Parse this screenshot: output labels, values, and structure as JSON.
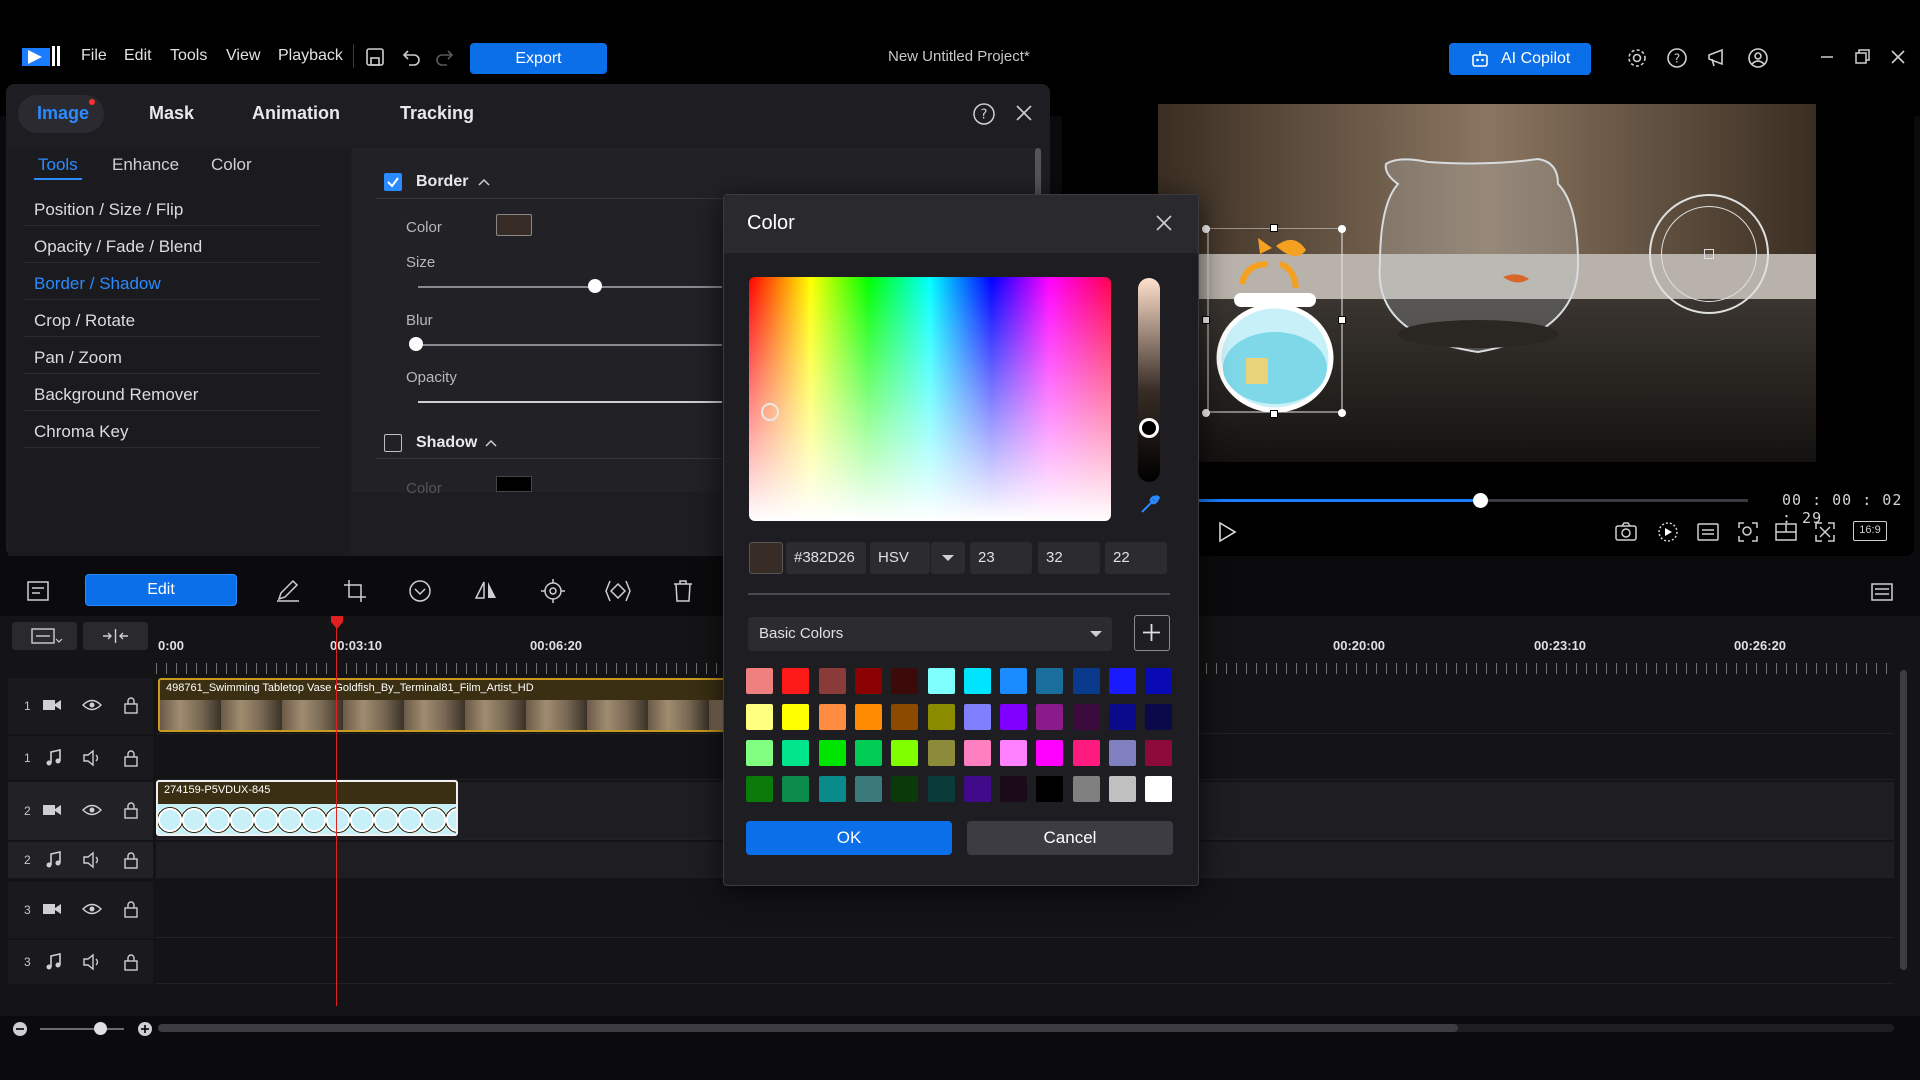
{
  "menu": [
    "File",
    "Edit",
    "Tools",
    "View",
    "Playback"
  ],
  "toolbar": {
    "export_label": "Export",
    "project_title": "New Untitled Project*",
    "ai_label": "AI Copilot"
  },
  "edit_panel": {
    "tabs": [
      "Image",
      "Mask",
      "Animation",
      "Tracking"
    ],
    "subtabs": [
      "Tools",
      "Enhance",
      "Color"
    ],
    "tools": [
      "Position / Size / Flip",
      "Opacity / Fade / Blend",
      "Border / Shadow",
      "Crop / Rotate",
      "Pan / Zoom",
      "Background Remover",
      "Chroma Key"
    ],
    "border": {
      "label": "Border",
      "enabled": true,
      "color_label": "Color",
      "size_label": "Size",
      "blur_label": "Blur",
      "opacity_label": "Opacity"
    },
    "shadow": {
      "label": "Shadow",
      "enabled": false,
      "color_label": "Color"
    }
  },
  "preview": {
    "timecode": "00 : 00 : 02 : 29",
    "aspect": "16:9",
    "progress": 0.52
  },
  "timeline": {
    "edit_label": "Edit",
    "ruler": [
      "0:00",
      "00:03:10",
      "00:06:20",
      "00:20:00",
      "00:23:10",
      "00:26:20"
    ],
    "track_numbers": [
      "1",
      "1",
      "2",
      "2",
      "3",
      "3"
    ],
    "clip1_name": "498761_Swimming Tabletop Vase Goldfish_By_Terminal81_Film_Artist_HD",
    "clip2_name": "274159-P5VDUX-845"
  },
  "color_dialog": {
    "title": "Color",
    "hex": "#382D26",
    "mode": "HSV",
    "h": "23",
    "s": "32",
    "v": "22",
    "palette_label": "Basic Colors",
    "ok_label": "OK",
    "cancel_label": "Cancel",
    "swatches": [
      [
        "#f08080",
        "#ff1a1a",
        "#8b3a3a",
        "#8b0000",
        "#3d0a0a",
        "#80ffff",
        "#00e5ff",
        "#1a8cff",
        "#1a6e9e",
        "#0a3a8c",
        "#1a1aff",
        "#0a0ab4"
      ],
      [
        "#ffff80",
        "#ffff00",
        "#ff8c40",
        "#ff8c00",
        "#8b4a00",
        "#8b8b00",
        "#8080ff",
        "#8000ff",
        "#8b1a8b",
        "#3d0a3d",
        "#0a0a8b",
        "#0a0a4a"
      ],
      [
        "#80ff80",
        "#00e58c",
        "#00e500",
        "#00cc55",
        "#80ff00",
        "#8b8b3a",
        "#ff80c0",
        "#ff80ff",
        "#ff00ff",
        "#ff1a80",
        "#8080c0",
        "#8b0a3a"
      ],
      [
        "#0a7a0a",
        "#0a8b4a",
        "#0a8b8b",
        "#3a7a7a",
        "#0a3a0a",
        "#0a3a3a",
        "#400a8b",
        "#1a0a1a",
        "#000000",
        "#808080",
        "#c0c0c0",
        "#ffffff"
      ]
    ]
  }
}
